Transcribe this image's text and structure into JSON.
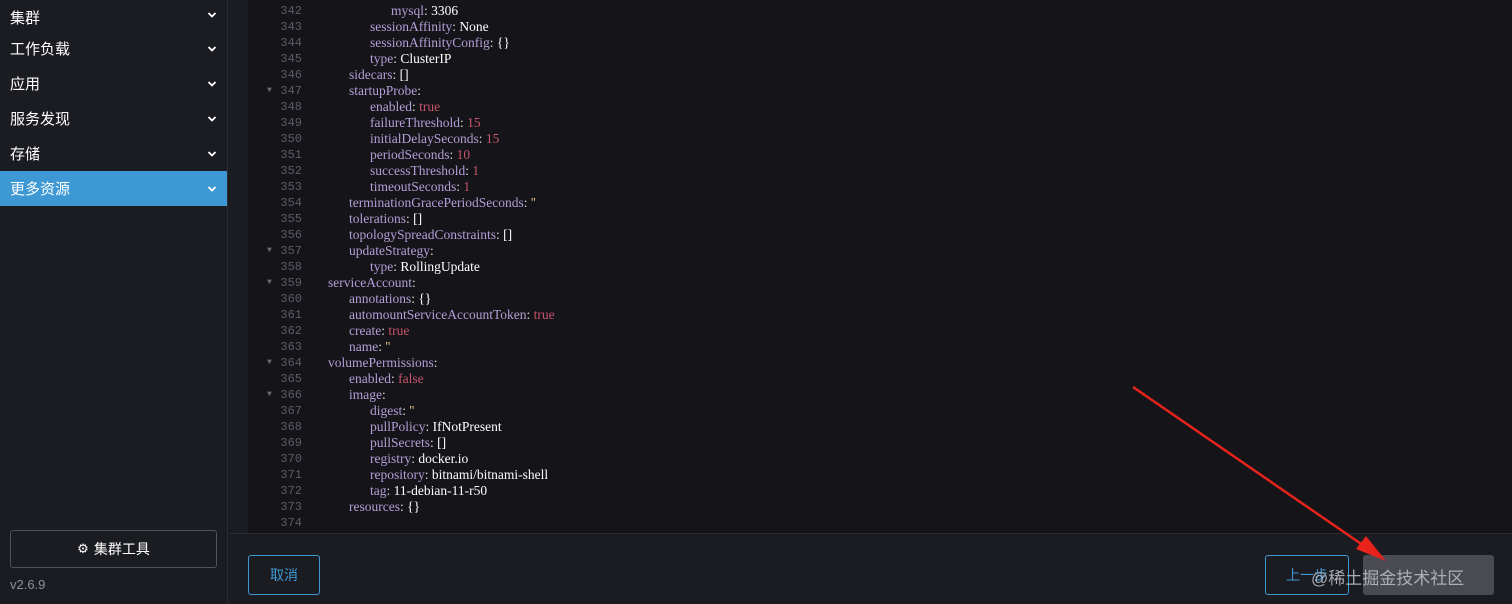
{
  "sidebar": {
    "items": [
      {
        "label": "集群"
      },
      {
        "label": "工作负载"
      },
      {
        "label": "应用"
      },
      {
        "label": "服务发现"
      },
      {
        "label": "存储"
      },
      {
        "label": "更多资源"
      }
    ],
    "active_index": 5,
    "tools_label": "集群工具",
    "tools_icon": "gear-icon",
    "version": "v2.6.9"
  },
  "editor": {
    "lines": [
      {
        "num": "342",
        "fold": false,
        "indent": 3,
        "key": "mysql",
        "value": "3306",
        "type": "plain"
      },
      {
        "num": "343",
        "fold": false,
        "indent": 2,
        "key": "sessionAffinity",
        "value": "None",
        "type": "plain"
      },
      {
        "num": "344",
        "fold": false,
        "indent": 2,
        "key": "sessionAffinityConfig",
        "value": "{}",
        "type": "plain"
      },
      {
        "num": "345",
        "fold": false,
        "indent": 2,
        "key": "type",
        "value": "ClusterIP",
        "type": "plain"
      },
      {
        "num": "346",
        "fold": false,
        "indent": 1,
        "key": "sidecars",
        "value": "[]",
        "type": "plain"
      },
      {
        "num": "347",
        "fold": true,
        "indent": 1,
        "key": "startupProbe",
        "value": "",
        "type": "none"
      },
      {
        "num": "348",
        "fold": false,
        "indent": 2,
        "key": "enabled",
        "value": "true",
        "type": "bool"
      },
      {
        "num": "349",
        "fold": false,
        "indent": 2,
        "key": "failureThreshold",
        "value": "15",
        "type": "num"
      },
      {
        "num": "350",
        "fold": false,
        "indent": 2,
        "key": "initialDelaySeconds",
        "value": "15",
        "type": "num"
      },
      {
        "num": "351",
        "fold": false,
        "indent": 2,
        "key": "periodSeconds",
        "value": "10",
        "type": "num"
      },
      {
        "num": "352",
        "fold": false,
        "indent": 2,
        "key": "successThreshold",
        "value": "1",
        "type": "num"
      },
      {
        "num": "353",
        "fold": false,
        "indent": 2,
        "key": "timeoutSeconds",
        "value": "1",
        "type": "num"
      },
      {
        "num": "354",
        "fold": false,
        "indent": 1,
        "key": "terminationGracePeriodSeconds",
        "value": "''",
        "type": "str"
      },
      {
        "num": "355",
        "fold": false,
        "indent": 1,
        "key": "tolerations",
        "value": "[]",
        "type": "plain"
      },
      {
        "num": "356",
        "fold": false,
        "indent": 1,
        "key": "topologySpreadConstraints",
        "value": "[]",
        "type": "plain"
      },
      {
        "num": "357",
        "fold": true,
        "indent": 1,
        "key": "updateStrategy",
        "value": "",
        "type": "none"
      },
      {
        "num": "358",
        "fold": false,
        "indent": 2,
        "key": "type",
        "value": "RollingUpdate",
        "type": "plain"
      },
      {
        "num": "359",
        "fold": true,
        "indent": 0,
        "key": "serviceAccount",
        "value": "",
        "type": "none"
      },
      {
        "num": "360",
        "fold": false,
        "indent": 1,
        "key": "annotations",
        "value": "{}",
        "type": "plain"
      },
      {
        "num": "361",
        "fold": false,
        "indent": 1,
        "key": "automountServiceAccountToken",
        "value": "true",
        "type": "bool"
      },
      {
        "num": "362",
        "fold": false,
        "indent": 1,
        "key": "create",
        "value": "true",
        "type": "bool"
      },
      {
        "num": "363",
        "fold": false,
        "indent": 1,
        "key": "name",
        "value": "''",
        "type": "str"
      },
      {
        "num": "364",
        "fold": true,
        "indent": 0,
        "key": "volumePermissions",
        "value": "",
        "type": "none"
      },
      {
        "num": "365",
        "fold": false,
        "indent": 1,
        "key": "enabled",
        "value": "false",
        "type": "bool"
      },
      {
        "num": "366",
        "fold": true,
        "indent": 1,
        "key": "image",
        "value": "",
        "type": "none"
      },
      {
        "num": "367",
        "fold": false,
        "indent": 2,
        "key": "digest",
        "value": "''",
        "type": "str"
      },
      {
        "num": "368",
        "fold": false,
        "indent": 2,
        "key": "pullPolicy",
        "value": "IfNotPresent",
        "type": "plain"
      },
      {
        "num": "369",
        "fold": false,
        "indent": 2,
        "key": "pullSecrets",
        "value": "[]",
        "type": "plain"
      },
      {
        "num": "370",
        "fold": false,
        "indent": 2,
        "key": "registry",
        "value": "docker.io",
        "type": "plain"
      },
      {
        "num": "371",
        "fold": false,
        "indent": 2,
        "key": "repository",
        "value": "bitnami/bitnami-shell",
        "type": "plain"
      },
      {
        "num": "372",
        "fold": false,
        "indent": 2,
        "key": "tag",
        "value": "11-debian-11-r50",
        "type": "plain"
      },
      {
        "num": "373",
        "fold": false,
        "indent": 1,
        "key": "resources",
        "value": "{}",
        "type": "plain"
      },
      {
        "num": "374",
        "fold": false,
        "indent": 0,
        "key": "",
        "value": "",
        "type": "none"
      }
    ]
  },
  "footer": {
    "cancel_label": "取消",
    "prev_label": "上一步",
    "watermark": "@稀土掘金技术社区"
  },
  "colors": {
    "accent": "#3d98d3",
    "key": "#b49fd8",
    "bool": "#c8556c",
    "string": "#e6c28a",
    "annotation_arrow": "#e8231c"
  }
}
